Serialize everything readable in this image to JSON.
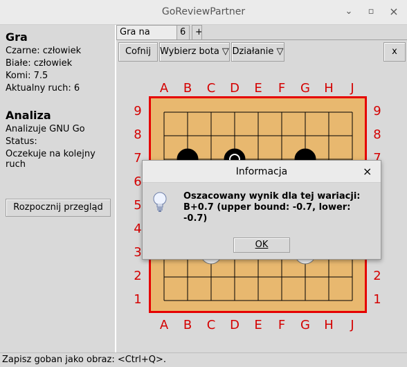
{
  "window": {
    "title": "GoReviewPartner",
    "minimize": "⌄",
    "maximize": "▫",
    "close": "×"
  },
  "left_panel": {
    "game_heading": "Gra",
    "black": "Czarne: człowiek",
    "white": "Białe: człowiek",
    "komi": "Komi: 7.5",
    "current_move": "Aktualny ruch: 6",
    "analysis_heading": "Analiza",
    "analyzer": "Analizuje GNU Go",
    "status_label": "Status:",
    "status_value": "Oczekuje na kolejny ruch",
    "start_review_button": "Rozpocznij przegląd"
  },
  "tabs": [
    {
      "label": "Gra na żywo"
    },
    {
      "label": "6"
    },
    {
      "label": "+"
    }
  ],
  "toolbar": {
    "undo": "Cofnij",
    "choose_bot": "Wybierz bota ▽",
    "action": "Działanie ▽",
    "close": "x"
  },
  "board": {
    "columns": [
      "A",
      "B",
      "C",
      "D",
      "E",
      "F",
      "G",
      "H",
      "J"
    ],
    "rows": [
      "9",
      "8",
      "7",
      "6",
      "5",
      "4",
      "3",
      "2",
      "1"
    ],
    "frame_color": "#e60000",
    "coord_color": "#d40000",
    "wood_color": "#e8b86f",
    "stones": [
      {
        "color": "black",
        "col": "B",
        "row": 7
      },
      {
        "color": "black",
        "col": "D",
        "row": 7,
        "last_move": true
      },
      {
        "color": "black",
        "col": "G",
        "row": 7
      },
      {
        "color": "white",
        "col": "C",
        "row": 3
      },
      {
        "color": "white",
        "col": "G",
        "row": 3
      }
    ]
  },
  "dialog": {
    "title": "Informacja",
    "close": "×",
    "icon": "lightbulb-icon",
    "message": "Oszacowany wynik dla tej wariacji: B+0.7 (upper bound: -0.7, lower: -0.7)",
    "ok": "OK"
  },
  "statusbar": {
    "text": "Zapisz goban jako obraz: <Ctrl+Q>."
  }
}
